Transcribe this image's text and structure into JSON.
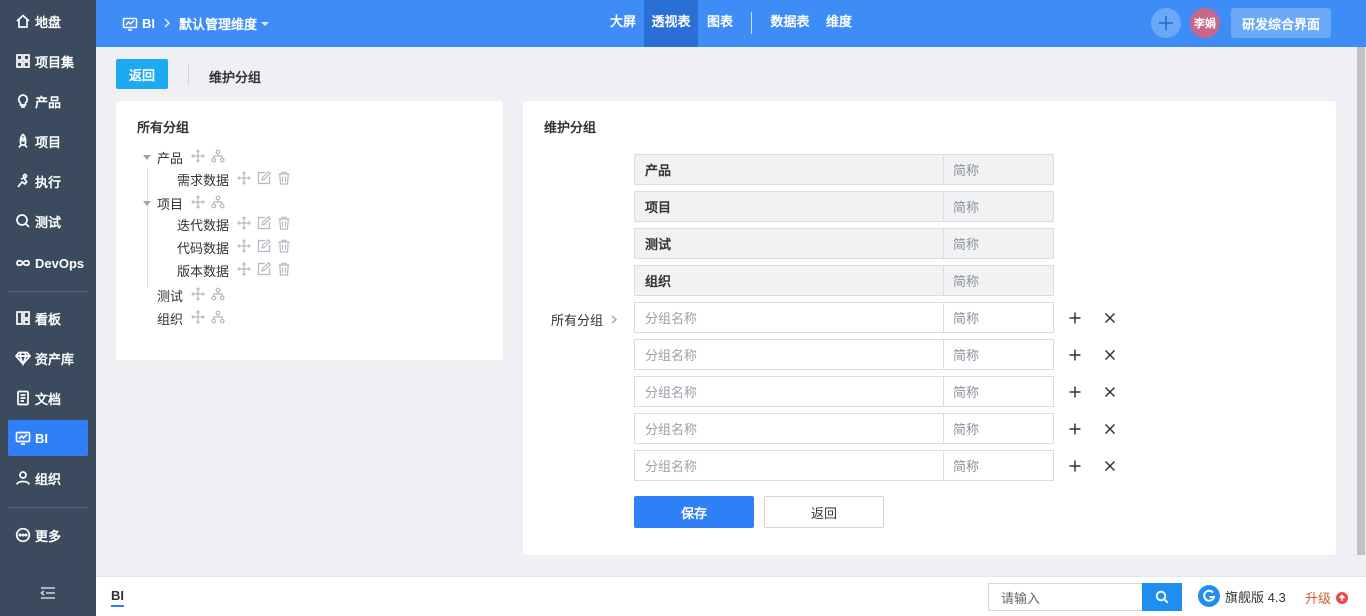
{
  "sidebar": {
    "items": [
      {
        "label": "地盘",
        "icon": "home-icon"
      },
      {
        "label": "项目集",
        "icon": "grid-icon"
      },
      {
        "label": "产品",
        "icon": "lightbulb-icon"
      },
      {
        "label": "项目",
        "icon": "rocket-icon"
      },
      {
        "label": "执行",
        "icon": "run-icon"
      },
      {
        "label": "测试",
        "icon": "magnifier-icon"
      },
      {
        "label": "DevOps",
        "icon": "infinity-icon"
      },
      {
        "label": "看板",
        "icon": "board-icon"
      },
      {
        "label": "资产库",
        "icon": "diamond-icon"
      },
      {
        "label": "文档",
        "icon": "doc-icon"
      },
      {
        "label": "BI",
        "icon": "bi-icon",
        "active": true
      },
      {
        "label": "组织",
        "icon": "user-icon"
      },
      {
        "label": "更多",
        "icon": "more-icon"
      }
    ]
  },
  "topbar": {
    "module": "BI",
    "dimension": "默认管理维度",
    "tabs": [
      "大屏",
      "透视表",
      "图表",
      "数据表",
      "维度"
    ],
    "active_tab": "透视表",
    "avatar_text": "李娟",
    "workspace_button": "研发综合界面"
  },
  "subheader": {
    "back_button": "返回",
    "title": "维护分组"
  },
  "left_panel": {
    "title": "所有分组",
    "tree": [
      {
        "label": "产品",
        "level": 0,
        "expandable": true
      },
      {
        "label": "需求数据",
        "level": 1
      },
      {
        "label": "项目",
        "level": 0,
        "expandable": true
      },
      {
        "label": "迭代数据",
        "level": 1
      },
      {
        "label": "代码数据",
        "level": 1
      },
      {
        "label": "版本数据",
        "level": 1
      },
      {
        "label": "测试",
        "level": 0
      },
      {
        "label": "组织",
        "level": 0
      }
    ]
  },
  "right_panel": {
    "title": "维护分组",
    "field_label": "所有分组",
    "fixed_rows": [
      {
        "name": "产品",
        "short": "简称"
      },
      {
        "name": "项目",
        "short": "简称"
      },
      {
        "name": "测试",
        "short": "简称"
      },
      {
        "name": "组织",
        "short": "简称"
      }
    ],
    "edit_rows": [
      {
        "name_placeholder": "分组名称",
        "short_placeholder": "简称"
      },
      {
        "name_placeholder": "分组名称",
        "short_placeholder": "简称"
      },
      {
        "name_placeholder": "分组名称",
        "short_placeholder": "简称"
      },
      {
        "name_placeholder": "分组名称",
        "short_placeholder": "简称"
      },
      {
        "name_placeholder": "分组名称",
        "short_placeholder": "简称"
      }
    ],
    "save_button": "保存",
    "back_button": "返回"
  },
  "footer": {
    "tab": "BI",
    "search_placeholder": "请输入",
    "edition": "旗舰版 4.3",
    "upgrade": "升级"
  },
  "colors": {
    "sidebar_bg": "#3c4a5e",
    "topbar_bg": "#3e8cf5",
    "primary": "#2f7ff7",
    "back_button_bg": "#1eaaf1"
  }
}
